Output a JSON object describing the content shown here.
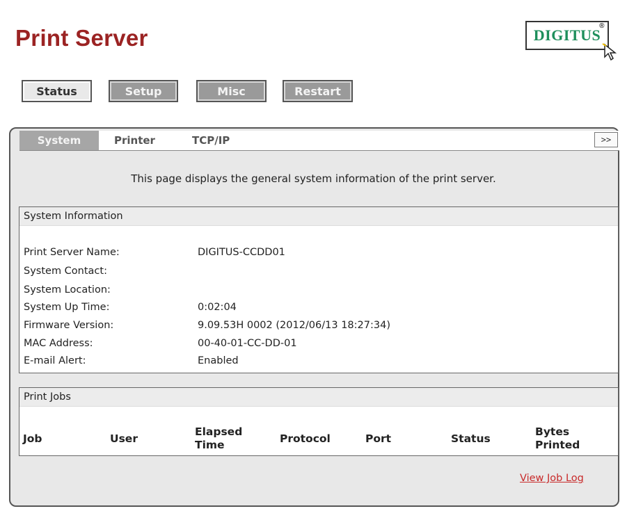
{
  "header": {
    "title": "Print Server",
    "logo_text": "DIGITUS",
    "logo_mark": "®"
  },
  "main_nav": [
    {
      "label": "Status",
      "active": true
    },
    {
      "label": "Setup",
      "active": false
    },
    {
      "label": "Misc",
      "active": false
    },
    {
      "label": "Restart",
      "active": false
    }
  ],
  "sub_tabs": [
    {
      "label": "System",
      "active": true
    },
    {
      "label": "Printer",
      "active": false
    },
    {
      "label": "TCP/IP",
      "active": false
    }
  ],
  "more_label": ">>",
  "description": "This page displays the general system information of the print server.",
  "system_info": {
    "heading": "System Information",
    "rows": [
      {
        "label": "Print Server Name:",
        "value": "DIGITUS-CCDD01"
      },
      {
        "label": "System Contact:",
        "value": ""
      },
      {
        "label": "System Location:",
        "value": ""
      },
      {
        "label": "System Up Time:",
        "value": "0:02:04"
      },
      {
        "label": "Firmware Version:",
        "value": "9.09.53H 0002 (2012/06/13 18:27:34)"
      },
      {
        "label": "MAC Address:",
        "value": "00-40-01-CC-DD-01"
      },
      {
        "label": "E-mail Alert:",
        "value": "Enabled"
      }
    ]
  },
  "print_jobs": {
    "heading": "Print Jobs",
    "columns": [
      {
        "line1": "Job",
        "line2": ""
      },
      {
        "line1": "User",
        "line2": ""
      },
      {
        "line1": "Elapsed",
        "line2": "Time"
      },
      {
        "line1": "Protocol",
        "line2": ""
      },
      {
        "line1": "Port",
        "line2": ""
      },
      {
        "line1": "Status",
        "line2": ""
      },
      {
        "line1": "Bytes",
        "line2": "Printed"
      }
    ]
  },
  "view_job_log": "View Job Log",
  "colors": {
    "title": "#9b2323",
    "logo": "#1e8f5c",
    "link": "#c82a2a",
    "inactive_button": "#9a9a9a"
  },
  "icons": {
    "logo_cursor": "cursor-arrow-icon"
  }
}
